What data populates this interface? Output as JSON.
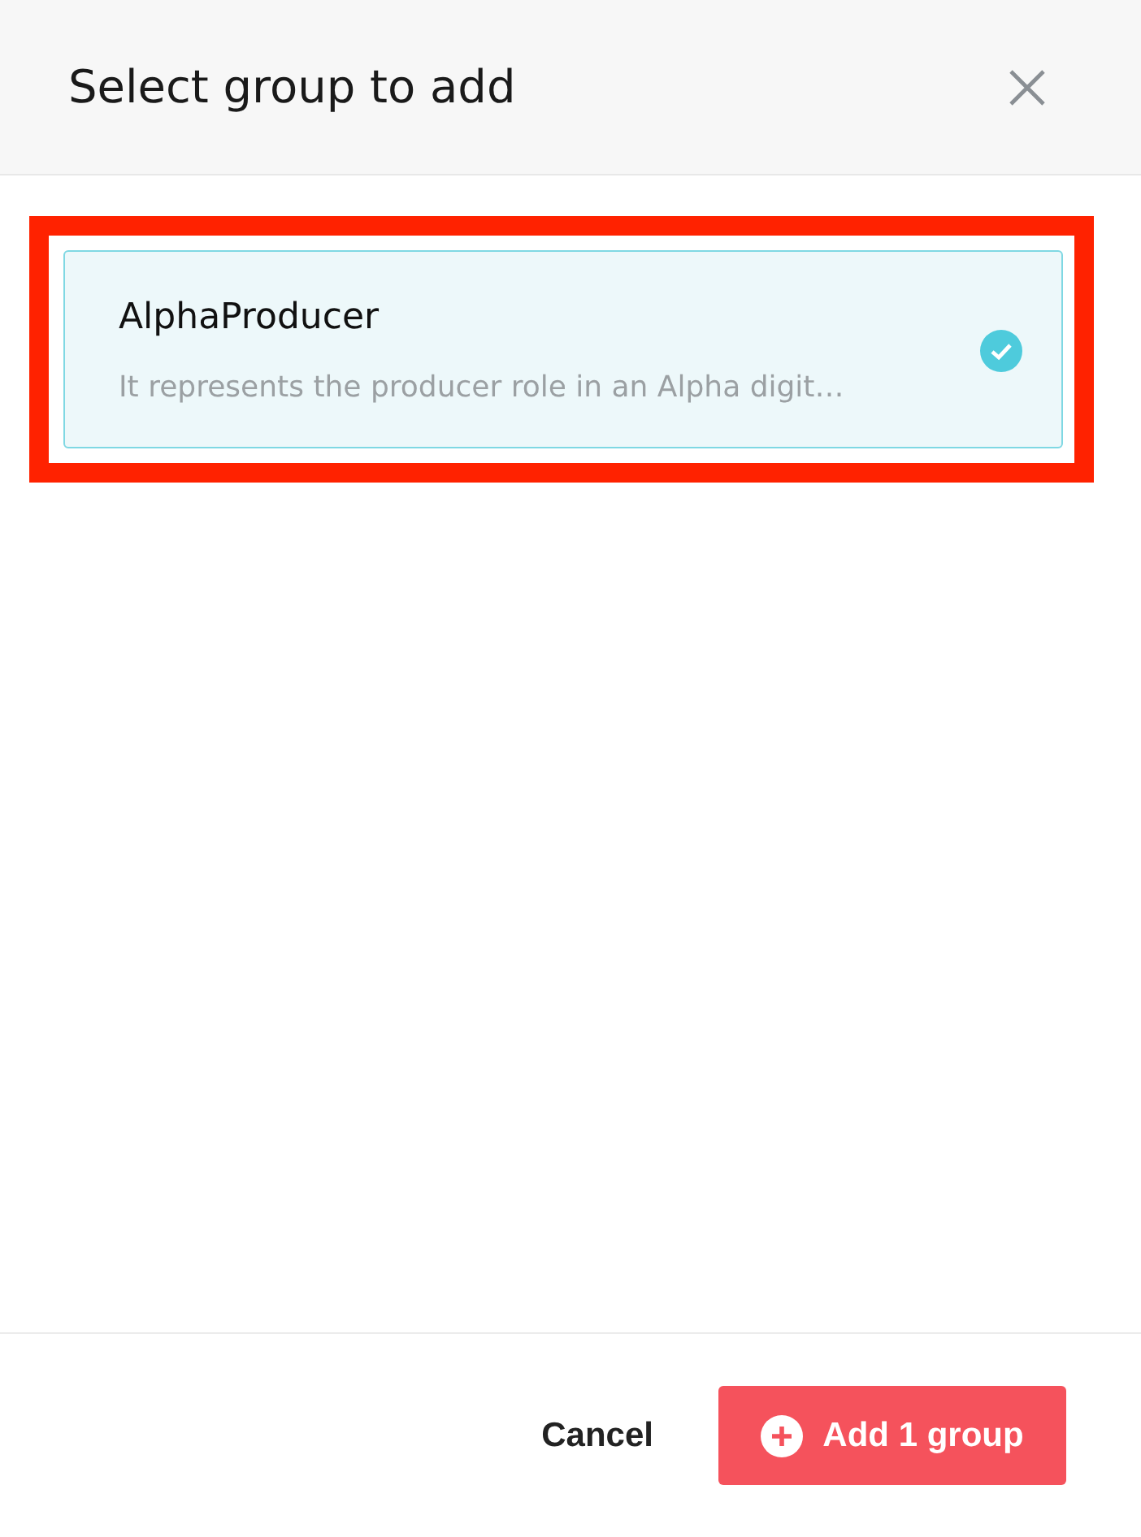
{
  "dialog": {
    "title": "Select group to add"
  },
  "groups": [
    {
      "name": "AlphaProducer",
      "description": "It represents the producer role in an Alpha digit…",
      "selected": true,
      "highlighted": true
    }
  ],
  "footer": {
    "cancel": "Cancel",
    "add": "Add 1 group"
  }
}
